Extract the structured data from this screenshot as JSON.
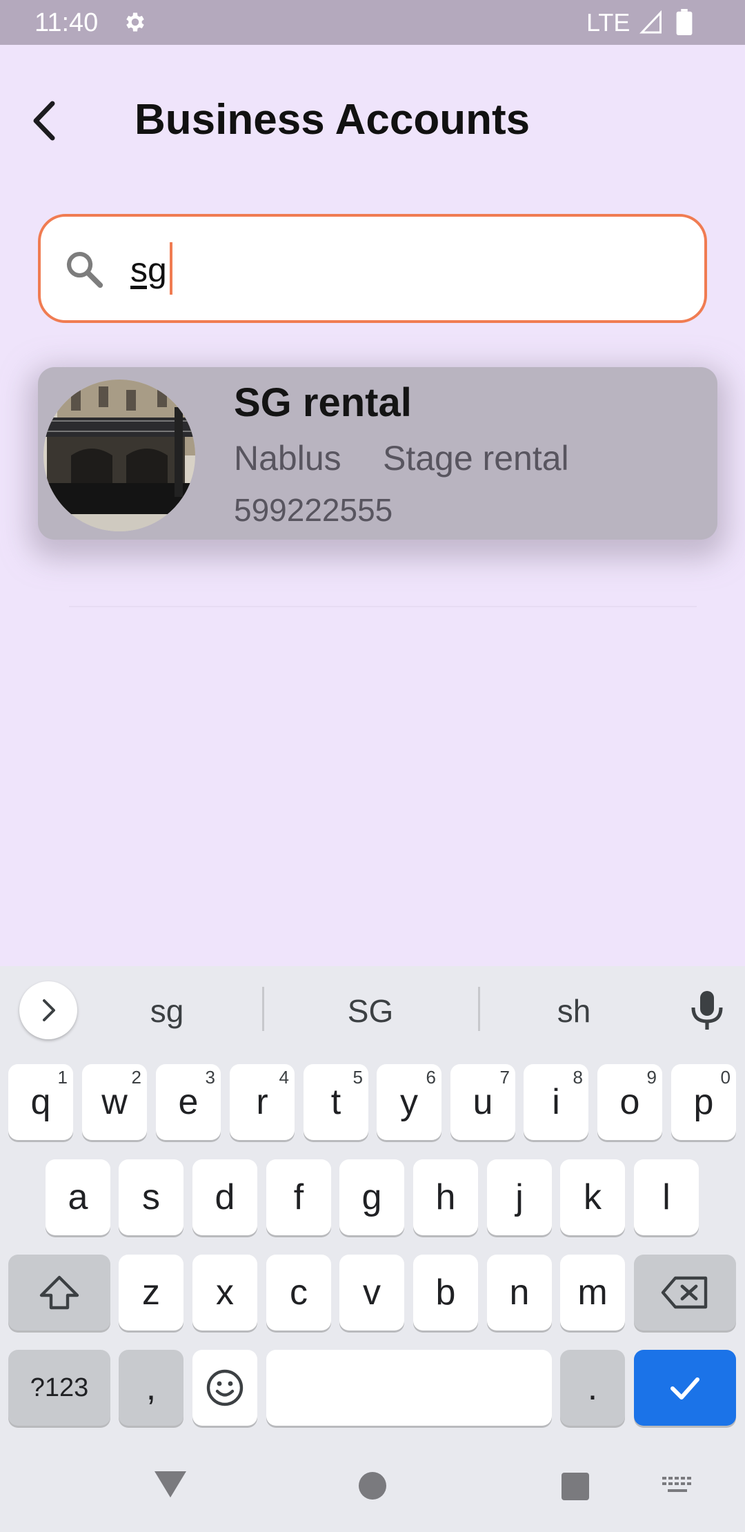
{
  "status_bar": {
    "time": "11:40",
    "network": "LTE",
    "icons": [
      "gear-icon",
      "signal-icon",
      "battery-icon"
    ]
  },
  "header": {
    "title": "Business Accounts",
    "back_icon": "back-arrow-icon"
  },
  "search": {
    "value": "sg",
    "icon": "search-icon",
    "accent_color": "#f07c52"
  },
  "results": [
    {
      "name": "SG rental",
      "city": "Nablus",
      "category": "Stage rental",
      "phone": "599222555",
      "avatar": "stage-photo"
    }
  ],
  "keyboard": {
    "suggestions": [
      "sg",
      "SG",
      "sh"
    ],
    "row1": [
      {
        "k": "q",
        "h": "1"
      },
      {
        "k": "w",
        "h": "2"
      },
      {
        "k": "e",
        "h": "3"
      },
      {
        "k": "r",
        "h": "4"
      },
      {
        "k": "t",
        "h": "5"
      },
      {
        "k": "y",
        "h": "6"
      },
      {
        "k": "u",
        "h": "7"
      },
      {
        "k": "i",
        "h": "8"
      },
      {
        "k": "o",
        "h": "9"
      },
      {
        "k": "p",
        "h": "0"
      }
    ],
    "row2": [
      "a",
      "s",
      "d",
      "f",
      "g",
      "h",
      "j",
      "k",
      "l"
    ],
    "row3": [
      "z",
      "x",
      "c",
      "v",
      "b",
      "n",
      "m"
    ],
    "symbols_label": "?123",
    "comma_label": ",",
    "period_label": ".",
    "enter_color": "#1b73e8"
  },
  "nav_bar": {
    "icons": [
      "nav-back-icon",
      "nav-home-icon",
      "nav-recents-icon",
      "keyboard-switch-icon"
    ]
  }
}
